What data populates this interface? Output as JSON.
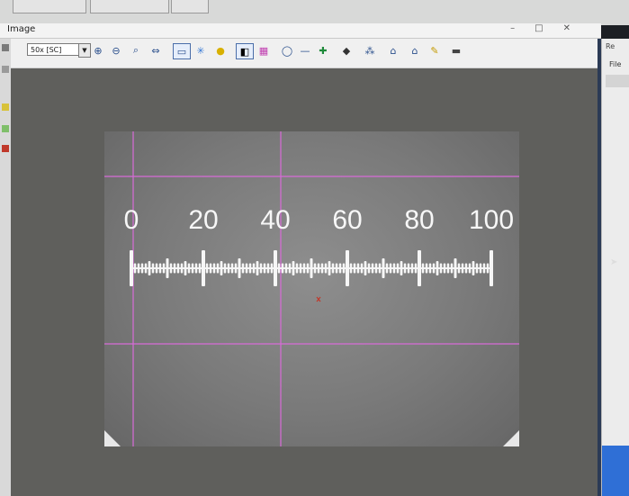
{
  "window": {
    "title": "Image"
  },
  "toolbar": {
    "magnification": "50x [SC]",
    "icons": [
      "zoom-in-icon",
      "zoom-out-icon",
      "zoom-fit-icon",
      "fit-width-icon",
      "select-rect-icon",
      "light-icon",
      "bulb-icon",
      "grayscale-icon",
      "color-icon",
      "measure-circle-icon",
      "measure-line-icon",
      "crosshair-icon",
      "pin-icon",
      "grid-icon",
      "home-icon",
      "scale-icon",
      "pencil-icon",
      "camera-icon"
    ]
  },
  "side_panel": {
    "title": "Re",
    "menu_file": "File"
  },
  "ruler": {
    "labels": [
      "0",
      "20",
      "40",
      "60",
      "80",
      "100"
    ]
  },
  "overlay_color": "#d86bd8"
}
